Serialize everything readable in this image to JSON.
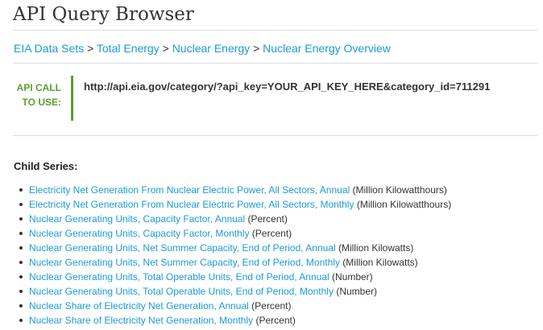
{
  "page": {
    "title": "API Query Browser"
  },
  "breadcrumb": {
    "separator": ">",
    "items": [
      {
        "label": "EIA Data Sets"
      },
      {
        "label": "Total Energy"
      },
      {
        "label": "Nuclear Energy"
      },
      {
        "label": "Nuclear Energy Overview"
      }
    ]
  },
  "api_call": {
    "label_line1": "API CALL",
    "label_line2": "TO USE:",
    "url": "http://api.eia.gov/category/?api_key=YOUR_API_KEY_HERE&category_id=711291"
  },
  "child_series": {
    "heading": "Child Series:",
    "items": [
      {
        "name": "Electricity Net Generation From Nuclear Electric Power, All Sectors, Annual",
        "unit": "(Million Kilowatthours)"
      },
      {
        "name": "Electricity Net Generation From Nuclear Electric Power, All Sectors, Monthly",
        "unit": "(Million Kilowatthours)"
      },
      {
        "name": "Nuclear Generating Units, Capacity Factor, Annual",
        "unit": "(Percent)"
      },
      {
        "name": "Nuclear Generating Units, Capacity Factor, Monthly",
        "unit": "(Percent)"
      },
      {
        "name": "Nuclear Generating Units, Net Summer Capacity, End of Period, Annual",
        "unit": "(Million Kilowatts)"
      },
      {
        "name": "Nuclear Generating Units, Net Summer Capacity, End of Period, Monthly",
        "unit": "(Million Kilowatts)"
      },
      {
        "name": "Nuclear Generating Units, Total Operable Units, End of Period, Annual",
        "unit": "(Number)"
      },
      {
        "name": "Nuclear Generating Units, Total Operable Units, End of Period, Monthly",
        "unit": "(Number)"
      },
      {
        "name": "Nuclear Share of Electricity Net Generation, Annual",
        "unit": "(Percent)"
      },
      {
        "name": "Nuclear Share of Electricity Net Generation, Monthly",
        "unit": "(Percent)"
      }
    ]
  },
  "colors": {
    "link": "#1a9bd7",
    "api_accent": "#5a9e32",
    "text": "#333333",
    "divider": "#dddddd"
  }
}
